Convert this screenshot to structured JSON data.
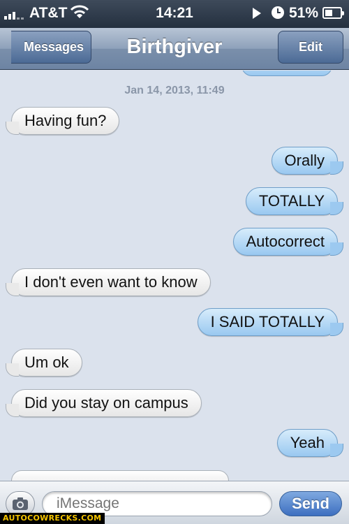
{
  "status_bar": {
    "carrier": "AT&T",
    "time": "14:21",
    "battery_percent": "51%",
    "battery_level": 0.51,
    "icons": [
      "signal-icon",
      "wifi-icon",
      "play-icon",
      "clock-icon",
      "battery-icon"
    ]
  },
  "nav": {
    "back_label": "Messages",
    "title": "Birthgiver",
    "edit_label": "Edit"
  },
  "conversation": {
    "timestamp": "Jan 14, 2013, 11:49",
    "messages": [
      {
        "direction": "in",
        "text": "Having fun?"
      },
      {
        "direction": "out",
        "text": "Orally"
      },
      {
        "direction": "out",
        "text": "TOTALLY"
      },
      {
        "direction": "out",
        "text": "Autocorrect"
      },
      {
        "direction": "in",
        "text": "I don't even want to know"
      },
      {
        "direction": "out",
        "text": "I SAID TOTALLY"
      },
      {
        "direction": "in",
        "text": "Um ok"
      },
      {
        "direction": "in",
        "text": "Did you stay on campus"
      },
      {
        "direction": "out",
        "text": "Yeah"
      }
    ]
  },
  "input_bar": {
    "placeholder": "iMessage",
    "send_label": "Send"
  },
  "watermark": "AUTOCOWRECKS.COM",
  "colors": {
    "incoming_bubble": "#e9e9e9",
    "outgoing_bubble": "#9cc9f0",
    "nav_bar": "#6d84a3",
    "send_button": "#3d6fc0",
    "background": "#dbe2ed"
  }
}
